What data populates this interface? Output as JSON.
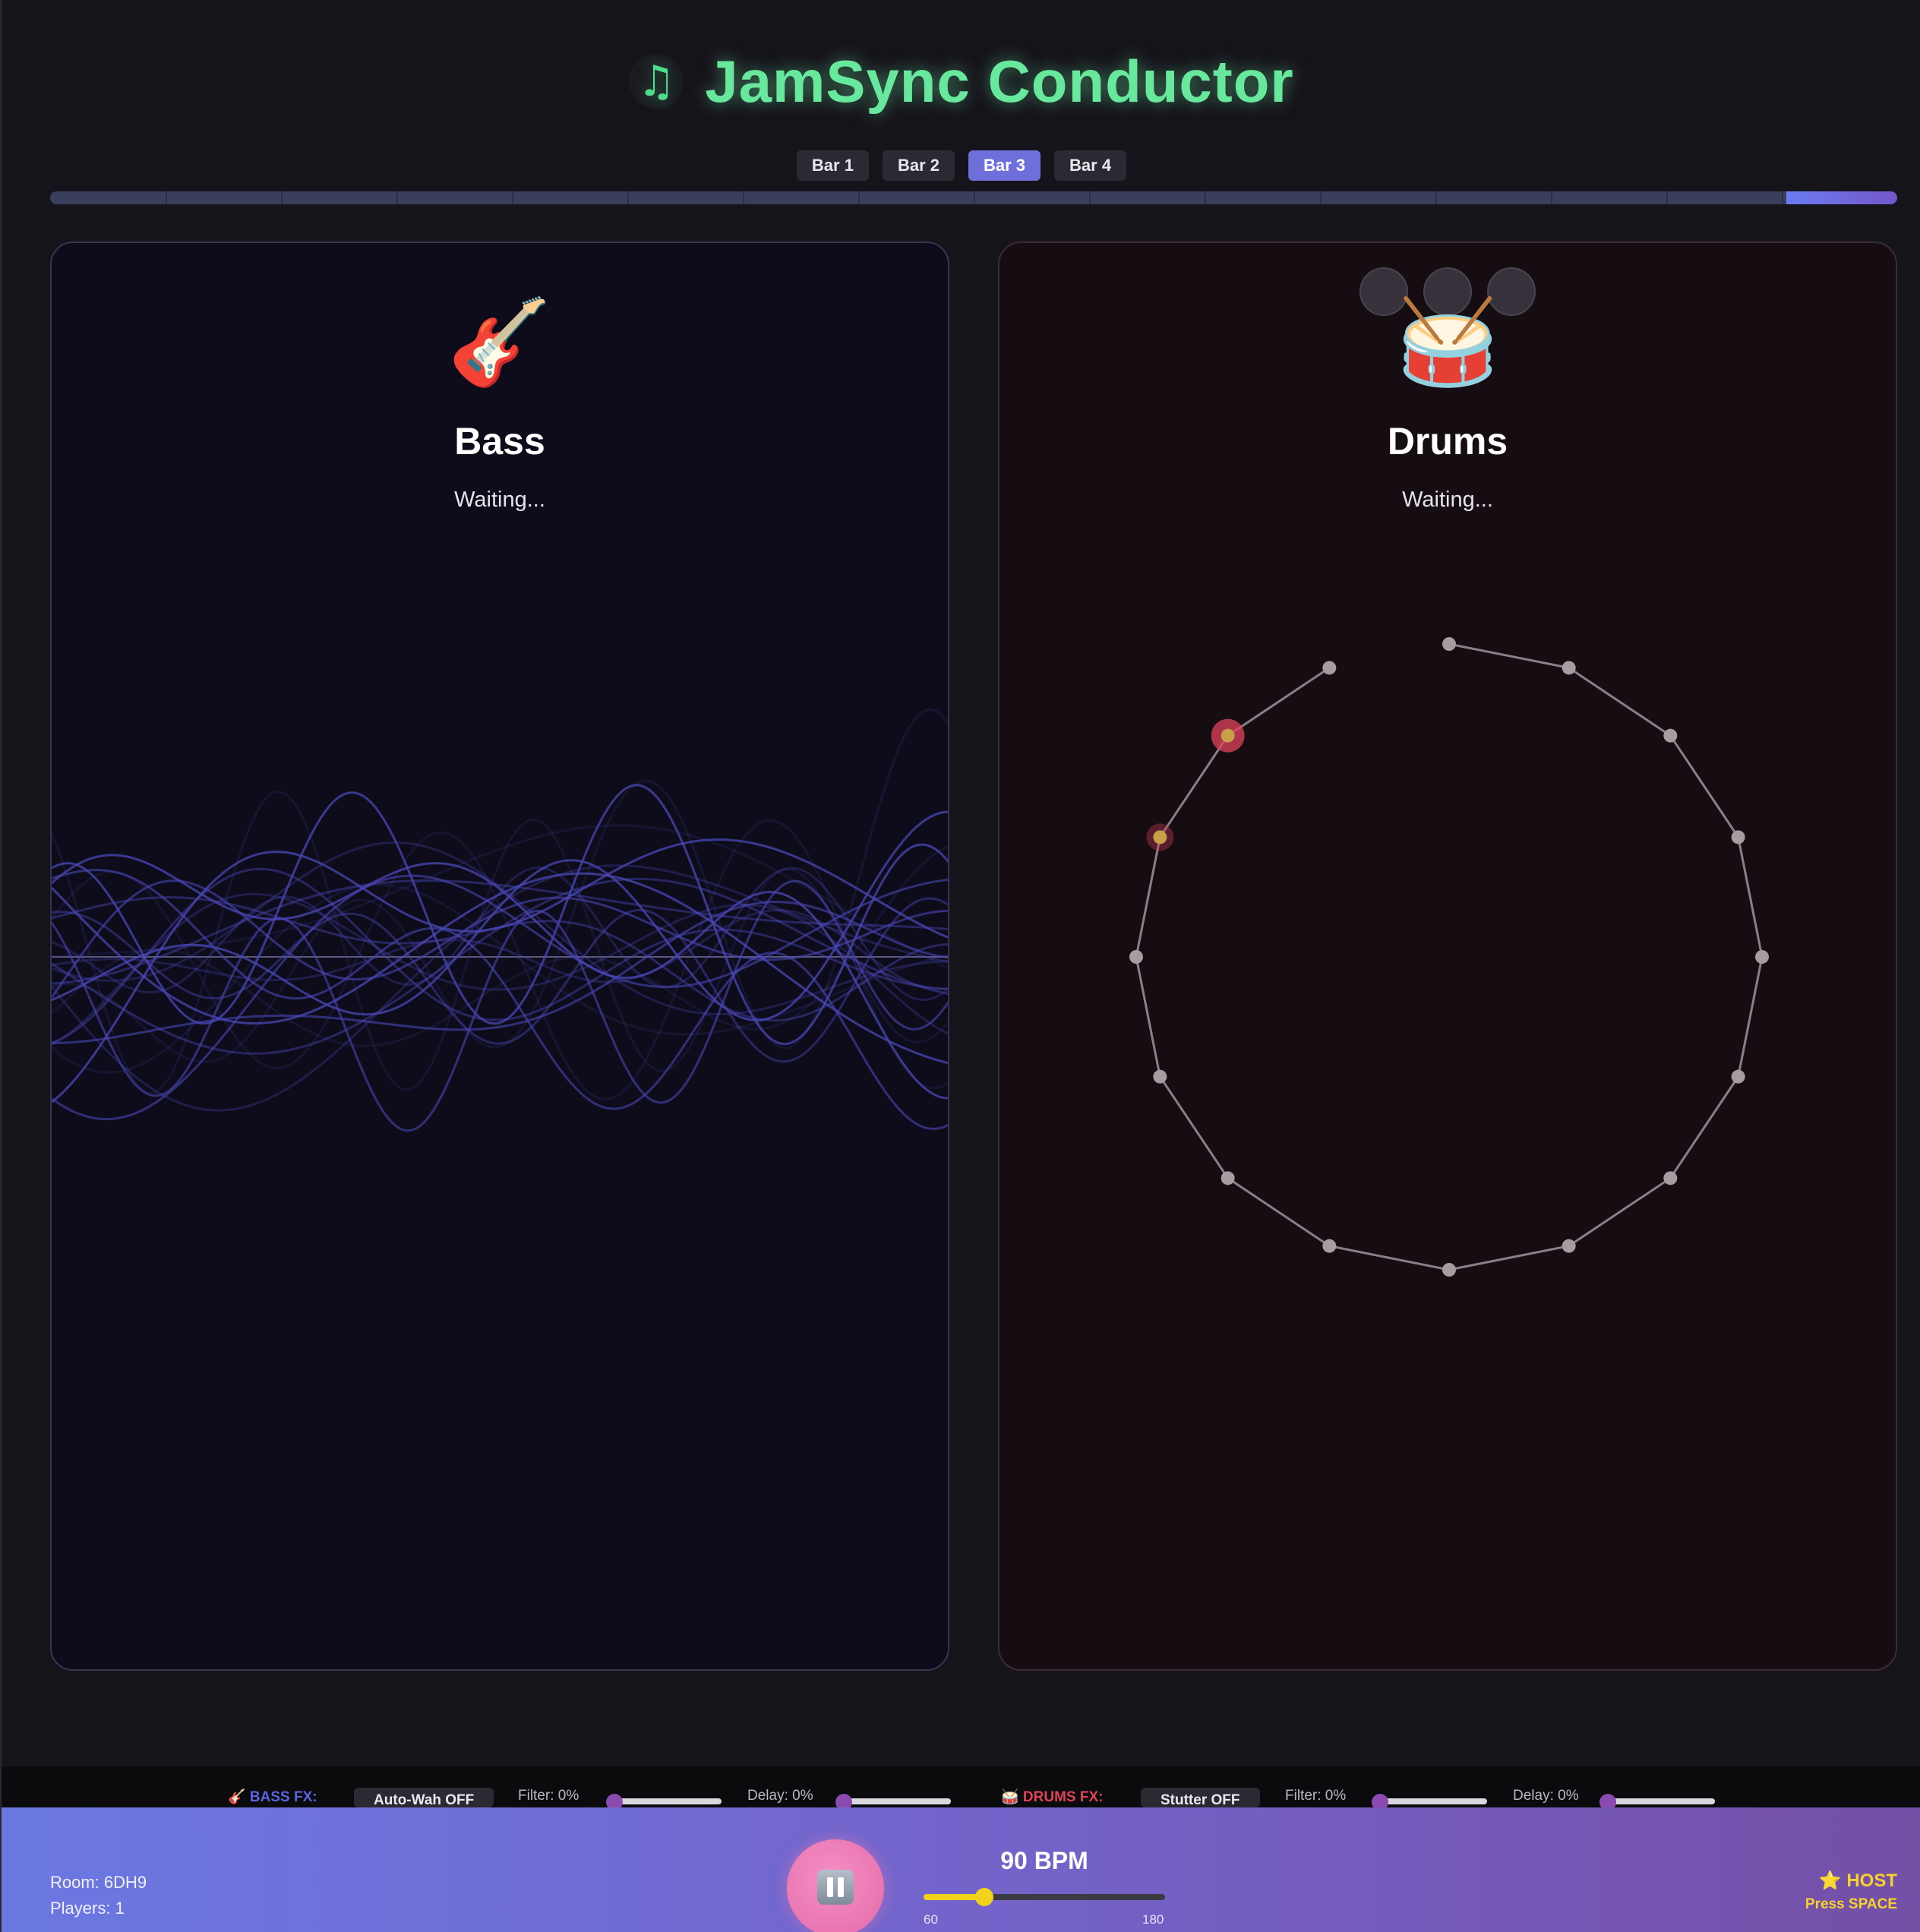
{
  "app": {
    "title": "JamSync Conductor",
    "logo_icon": "♫",
    "accent_color": "#67e89c"
  },
  "bar_tabs": [
    {
      "label": "Bar 1",
      "active": false
    },
    {
      "label": "Bar 2",
      "active": false
    },
    {
      "label": "Bar 3",
      "active": true
    },
    {
      "label": "Bar 4",
      "active": false
    }
  ],
  "progress": {
    "fraction": 0.06,
    "segments": 16
  },
  "bass": {
    "icon": "🎸",
    "name": "Bass",
    "status": "Waiting...",
    "color": "#4a48b8"
  },
  "drums": {
    "icon": "🥁",
    "name": "Drums",
    "status": "Waiting...",
    "steps": 16,
    "active_steps": [
      13,
      14
    ],
    "color": "#e0425c"
  },
  "fx": {
    "bass": {
      "label": "🎸 BASS FX:",
      "toggle_label": "Auto-Wah OFF",
      "filter_label": "Filter: 0%",
      "filter_value": 0,
      "delay_label": "Delay: 0%",
      "delay_value": 0
    },
    "drums": {
      "label": "🥁 DRUMS FX:",
      "toggle_label": "Stutter OFF",
      "filter_label": "Filter: 0%",
      "filter_value": 0,
      "delay_label": "Delay: 0%",
      "delay_value": 0
    }
  },
  "footer": {
    "room": "Room: 6DH9",
    "players": "Players: 1",
    "bpm_label": "90 BPM",
    "bpm": 90,
    "bpm_min": 60,
    "bpm_max": 180,
    "bpm_min_label": "60",
    "bpm_max_label": "180",
    "host_label": "⭐ HOST",
    "host_hint": "Press SPACE"
  }
}
